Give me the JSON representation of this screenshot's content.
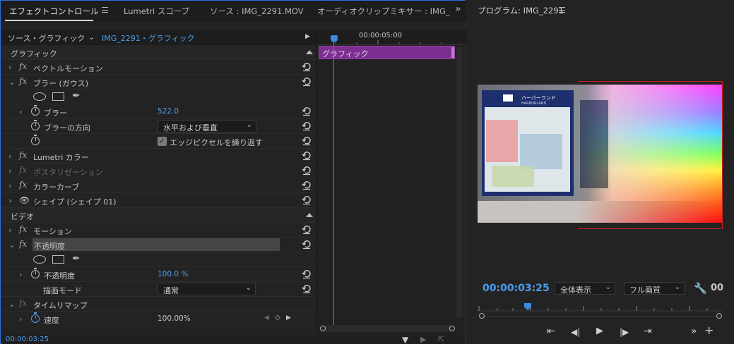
{
  "tabs": {
    "effect_controls": "エフェクトコントロール",
    "lumetri_scope": "Lumetri スコープ",
    "source": "ソース : IMG_2291.MOV",
    "audio_mixer": "オーディオクリップミキサー : IMG_",
    "overflow": "»"
  },
  "source_row": {
    "source_label": "ソース・グラフィック",
    "clip_label": "IMG_2291・グラフィック",
    "play_icon": "play-triangle-icon"
  },
  "sections": {
    "graphic": "グラフィック",
    "video": "ビデオ"
  },
  "effects": {
    "vector_motion": "ベクトルモーション",
    "blur_gauss": "ブラー (ガウス)",
    "blur": "ブラー",
    "blur_value": "522.0",
    "blur_direction": "ブラーの方向",
    "blur_direction_value": "水平および垂直",
    "repeat_edge": "エッジピクセルを繰り返す",
    "lumetri_color": "Lumetri カラー",
    "posterize": "ポスタリゼーション",
    "color_curve": "カラーカーブ",
    "shape": "シェイプ (シェイプ 01)",
    "motion": "モーション",
    "opacity_group": "不透明度",
    "opacity": "不透明度",
    "opacity_value": "100.0 %",
    "blend_mode": "描画モード",
    "blend_mode_value": "通常",
    "time_remap": "タイムリマップ",
    "speed": "速度",
    "speed_value": "100.00%"
  },
  "mini_timeline": {
    "timecode_label": "00:00:05:00",
    "clip_name": "グラフィック"
  },
  "status": {
    "timecode": "00:00:03:25"
  },
  "program": {
    "title": "プログラム: IMG_2291",
    "timecode": "00:00:03:25",
    "fit": "全体表示",
    "quality": "フル画質",
    "number": "00"
  },
  "video_sign": {
    "title": "ハーバーランド",
    "sub": "HARBORLAND"
  },
  "colors": {
    "accent": "#4a9ff0",
    "clip": "#7c2e8f",
    "panel_border": "#2e6fd6"
  }
}
